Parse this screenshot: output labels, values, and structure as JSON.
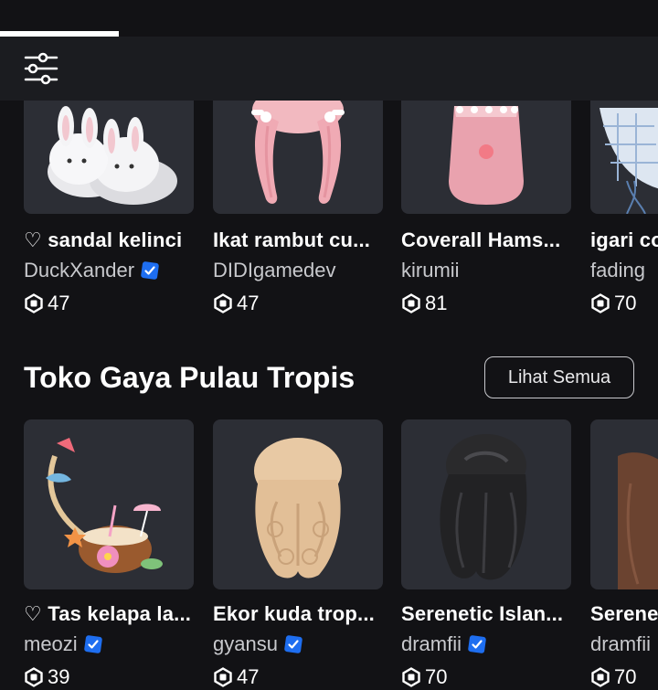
{
  "filter": {
    "icon": "sliders-icon"
  },
  "row1": {
    "items": [
      {
        "name": "♡ sandal kelinci",
        "creator": "DuckXander",
        "verified": true,
        "price": "47"
      },
      {
        "name": "Ikat rambut cu...",
        "creator": "DIDIgamedev",
        "verified": false,
        "price": "47"
      },
      {
        "name": "Coverall Hams...",
        "creator": "kirumii",
        "verified": false,
        "price": "81"
      },
      {
        "name": "igari co",
        "creator": "fading",
        "verified": false,
        "price": "70"
      }
    ]
  },
  "section": {
    "title": "Toko Gaya Pulau Tropis",
    "see_all": "Lihat Semua",
    "items": [
      {
        "name": "♡ Tas kelapa la...",
        "creator": "meozi",
        "verified": true,
        "price": "39"
      },
      {
        "name": "Ekor kuda trop...",
        "creator": "gyansu",
        "verified": true,
        "price": "47"
      },
      {
        "name": "Serenetic Islan...",
        "creator": "dramfii",
        "verified": true,
        "price": "70"
      },
      {
        "name": "Serene",
        "creator": "dramfii",
        "verified": false,
        "price": "70"
      }
    ]
  },
  "colors": {
    "background": "#121215",
    "card": "#2c2e35",
    "verified": "#1e6ef0",
    "muted_text": "#c8c9cd"
  }
}
